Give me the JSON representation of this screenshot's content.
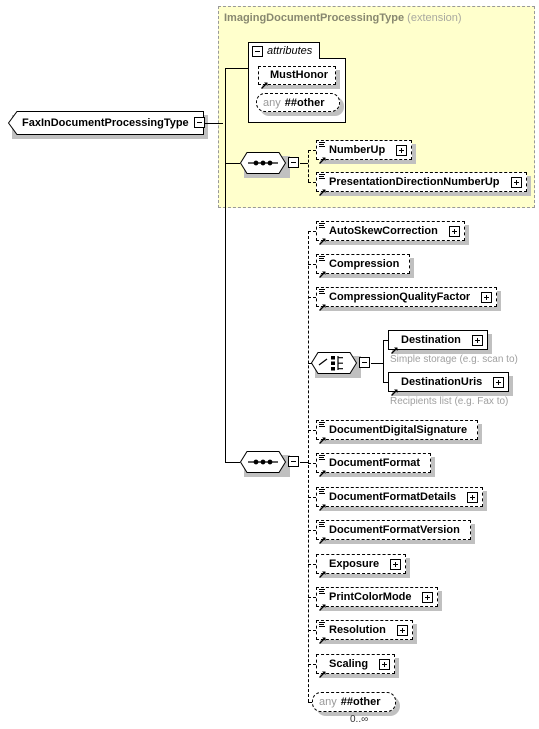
{
  "diagram": {
    "type": "xml-schema-diagram",
    "root": {
      "name": "FaxInDocumentProcessingType",
      "toggle": "minus"
    },
    "extension": {
      "title": "ImagingDocumentProcessingType",
      "subtitle": "(extension)"
    },
    "attributes": {
      "label": "attributes",
      "toggle": "minus",
      "items": [
        {
          "name": "MustHonor",
          "kind": "attribute",
          "style": "optional"
        },
        {
          "name": "any ##other",
          "any_prefix": "any",
          "any_suffix": "##other",
          "kind": "any"
        }
      ]
    },
    "compositors": {
      "sequence_top": {
        "kind": "sequence",
        "toggle": "minus"
      },
      "choice_destination": {
        "kind": "choice",
        "toggle": "minus"
      },
      "sequence_main": {
        "kind": "sequence",
        "toggle": "minus"
      }
    },
    "extension_elements": [
      {
        "name": "NumberUp",
        "expand": "plus",
        "detail": true,
        "style": "optional"
      },
      {
        "name": "PresentationDirectionNumberUp",
        "expand": "plus",
        "detail": true,
        "style": "optional"
      }
    ],
    "base_elements": [
      {
        "name": "AutoSkewCorrection",
        "expand": "plus",
        "detail": true,
        "style": "optional"
      },
      {
        "name": "Compression",
        "expand": "none",
        "detail": true,
        "style": "optional"
      },
      {
        "name": "CompressionQualityFactor",
        "expand": "plus",
        "detail": true,
        "style": "optional"
      },
      {
        "name": "DocumentDigitalSignature",
        "expand": "none",
        "detail": true,
        "style": "optional"
      },
      {
        "name": "DocumentFormat",
        "expand": "none",
        "detail": true,
        "style": "optional"
      },
      {
        "name": "DocumentFormatDetails",
        "expand": "plus",
        "detail": true,
        "style": "optional"
      },
      {
        "name": "DocumentFormatVersion",
        "expand": "none",
        "detail": true,
        "style": "optional"
      },
      {
        "name": "Exposure",
        "expand": "plus",
        "detail": false,
        "style": "optional"
      },
      {
        "name": "PrintColorMode",
        "expand": "plus",
        "detail": true,
        "style": "optional"
      },
      {
        "name": "Resolution",
        "expand": "plus",
        "detail": true,
        "style": "optional"
      },
      {
        "name": "Scaling",
        "expand": "plus",
        "detail": false,
        "style": "optional"
      }
    ],
    "choice_elements": [
      {
        "name": "Destination",
        "expand": "plus",
        "style": "required",
        "annotation": "Simple storage (e.g. scan to)"
      },
      {
        "name": "DestinationUris",
        "expand": "plus",
        "style": "required",
        "annotation": "Recipients list (e.g. Fax to)"
      }
    ],
    "wildcard": {
      "any_prefix": "any",
      "any_suffix": "##other",
      "cardinality": "0..∞"
    },
    "colors": {
      "extension_fill": "#ffffcc",
      "extension_border": "#999999",
      "extension_title": "#888870",
      "annotation": "#a0a0a0",
      "node_fill": "#ffffff",
      "line": "#000000",
      "shadow": "#c0c0c0"
    }
  }
}
